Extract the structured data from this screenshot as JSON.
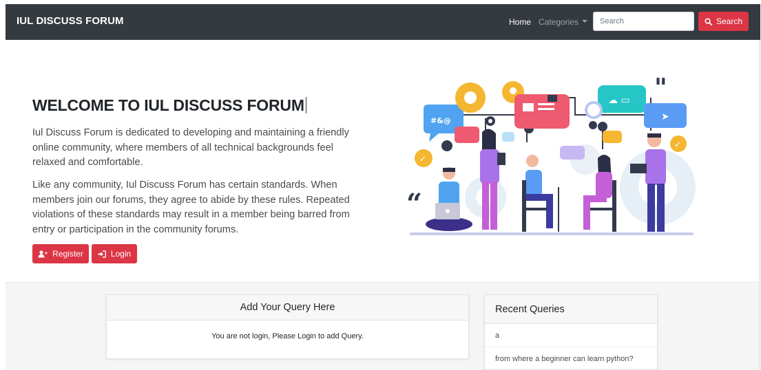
{
  "navbar": {
    "brand": "IUL DISCUSS FORUM",
    "home": "Home",
    "categories": "Categories",
    "search_placeholder": "Search",
    "search_button": "Search"
  },
  "hero": {
    "title": "WELCOME TO IUL DISCUSS FORUM",
    "paragraph1": "Iul Discuss Forum is dedicated to developing and maintaining a friendly online community, where members of all technical backgrounds feel relaxed and comfortable.",
    "paragraph2": "Like any community, Iul Discuss Forum has certain standards. When members join our forums, they agree to abide by these rules. Repeated violations of these standards may result in a member being barred from entry or participation in the community forums.",
    "register_button": "Register",
    "login_button": "Login",
    "illustration_icon": "community-discussion-illustration"
  },
  "query_card": {
    "title": "Add Your Query Here",
    "message": "You are not login, Please Login to add Query."
  },
  "recent_card": {
    "title": "Recent Queries",
    "items": [
      "a",
      "from where a beginner can learn python?"
    ]
  },
  "colors": {
    "navbar_bg": "#343a40",
    "accent_red": "#dc3545",
    "section_bg": "#f5f5f5"
  }
}
